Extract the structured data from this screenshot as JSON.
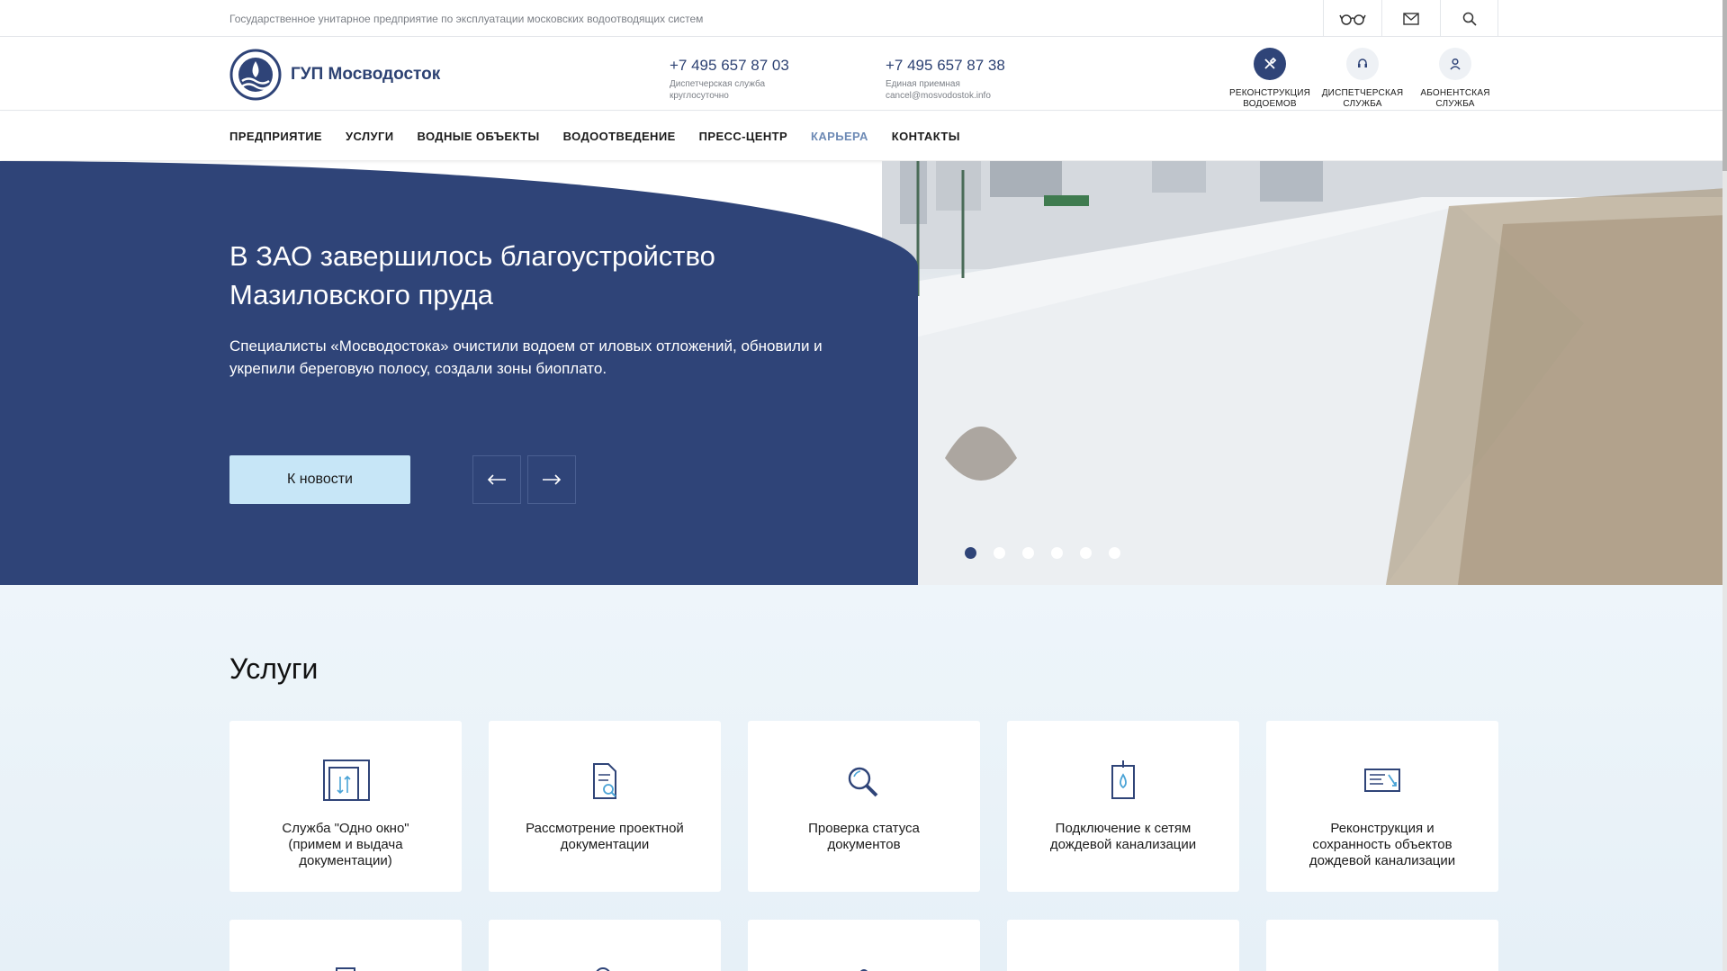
{
  "topbar": {
    "tagline": "Государственное унитарное предприятие по эксплуатации московских водоотводящих систем",
    "icons": [
      "glasses-icon",
      "mail-icon",
      "search-icon"
    ]
  },
  "header": {
    "logo_title": "ГУП Мосводосток",
    "phone1": {
      "number": "+7 495 657 87 03",
      "caption": "Диспетчерская служба круглосуточно"
    },
    "phone2": {
      "number": "+7 495 657 87 38",
      "caption1": "Единая приемная",
      "caption2": "cancel@mosvodostok.info"
    },
    "services": [
      {
        "label": "РЕКОНСТРУКЦИЯ ВОДОЕМОВ",
        "icon": "tools-icon"
      },
      {
        "label": "ДИСПЕТЧЕРСКАЯ СЛУЖБА",
        "icon": "headset-icon"
      },
      {
        "label": "АБОНЕНТСКАЯ СЛУЖБА",
        "icon": "user-icon"
      }
    ]
  },
  "nav": {
    "items": [
      "ПРЕДПРИЯТИЕ",
      "УСЛУГИ",
      "ВОДНЫЕ ОБЪЕКТЫ",
      "ВОДООТВЕДЕНИЕ",
      "ПРЕСС-ЦЕНТР",
      "КАРЬЕРА",
      "КОНТАКТЫ"
    ],
    "active": "КАРЬЕРА"
  },
  "hero": {
    "title": "В ЗАО завершилось благоустройство Мазиловского пруда",
    "text": "Специалисты «Мосводостока» очистили водоем от иловых отложений, обновили и укрепили береговую полосу, создали зоны биоплато.",
    "button": "К новости",
    "slides_count": 6,
    "active_slide": 1
  },
  "services": {
    "title": "Услуги",
    "cards": [
      {
        "label": "Служба \"Одно окно\" (примем и выдача документации)",
        "icon": "documents-exchange-icon"
      },
      {
        "label": "Рассмотрение проектной документации",
        "icon": "document-search-icon"
      },
      {
        "label": "Проверка статуса документов",
        "icon": "magnifier-icon"
      },
      {
        "label": "Подключение к сетям дождевой канализации",
        "icon": "water-drop-device-icon"
      },
      {
        "label": "Реконструкция и сохранность объектов дождевой канализации",
        "icon": "blueprint-icon"
      }
    ]
  },
  "colors": {
    "brand": "#2f4478",
    "accent": "#c7e6f7",
    "active_nav": "#6d8ab5"
  }
}
